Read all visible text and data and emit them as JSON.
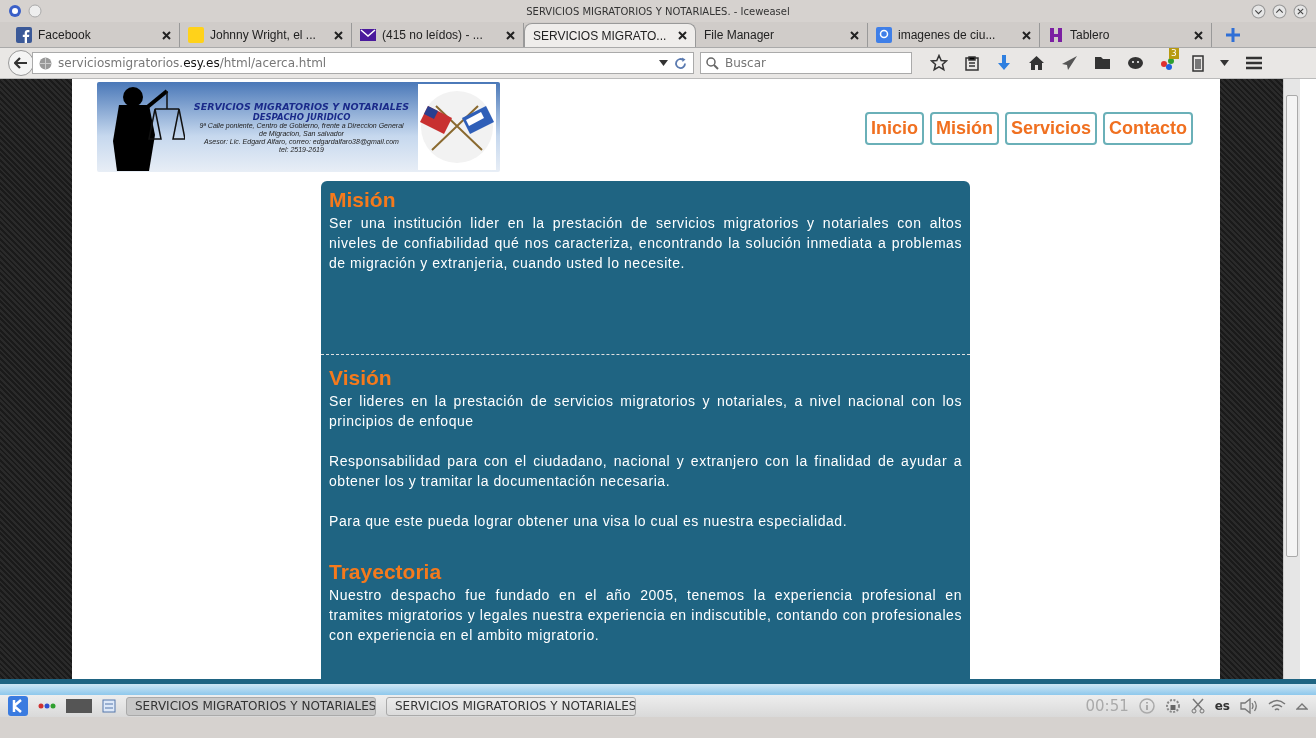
{
  "window": {
    "title": "SERVICIOS MIGRATORIOS Y NOTARIALES. - Iceweasel"
  },
  "tabs": [
    {
      "label": "Facebook",
      "kind": "facebook",
      "selected": false
    },
    {
      "label": "Johnny Wright, el ...",
      "kind": "note",
      "selected": false
    },
    {
      "label": "(415 no leídos) - ...",
      "kind": "mail",
      "selected": false
    },
    {
      "label": "SERVICIOS MIGRATO...",
      "kind": "page",
      "selected": true
    },
    {
      "label": "File Manager",
      "kind": "page",
      "selected": false
    },
    {
      "label": "imagenes de ciu...",
      "kind": "google",
      "selected": false
    },
    {
      "label": "Tablero",
      "kind": "board",
      "selected": false
    }
  ],
  "address_bar": {
    "url_start": "serviciosmigratorios.",
    "url_domain": "esy.es",
    "url_end": "/html/acerca.html"
  },
  "search": {
    "placeholder": "Buscar"
  },
  "toolbar": {
    "badge": "3"
  },
  "banner": {
    "title": "SERVICIOS MIGRATORIOS Y NOTARIALES",
    "subtitle": "DESPACHO JURIDICO",
    "lines": [
      "9ª Calle poniente, Centro de Gobierno, frente a Direccion General",
      "de Migracion, San salvador",
      "Asesor: Lic. Edgard Alfaro, correo: edgardalfaro38@gmail.com",
      "tel: 2519-2619"
    ]
  },
  "nav_links": [
    "Inicio",
    "Misión",
    "Servicios",
    "Contacto"
  ],
  "sections": [
    {
      "title": "Misión",
      "divider_after": true,
      "paragraphs": [
        "Ser una institución lider en la prestación de servicios migratorios y notariales con altos niveles de confiabilidad qué nos caracteriza, encontrando la solución inmediata a problemas de migración y extranjeria, cuando usted lo necesite."
      ]
    },
    {
      "title": "Visión",
      "divider_after": false,
      "paragraphs": [
        "Ser lideres en la prestación de servicios migratorios y notariales, a nivel nacional con los principios de enfoque",
        "Responsabilidad para con el ciudadano, nacional y extranjero con la finalidad de ayudar a obtener los y tramitar la documentación necesaria.",
        "Para que este pueda lograr obtener una visa lo cual es nuestra especialidad."
      ]
    },
    {
      "title": "Trayectoria",
      "divider_after": false,
      "paragraphs": [
        "Nuestro despacho fue fundado en el año 2005, tenemos la experiencia profesional en tramites migratorios y legales nuestra experiencia en indiscutible, contando con profesionales con experiencia en el ambito migratorio."
      ]
    }
  ],
  "taskbar": {
    "tasks": [
      {
        "label": "SERVICIOS MIGRATORIOS Y NOTARIALES",
        "selected": true
      },
      {
        "label": "SERVICIOS MIGRATORIOS Y NOTARIALES",
        "selected": false
      }
    ],
    "clock": "00:51",
    "language": "es"
  }
}
